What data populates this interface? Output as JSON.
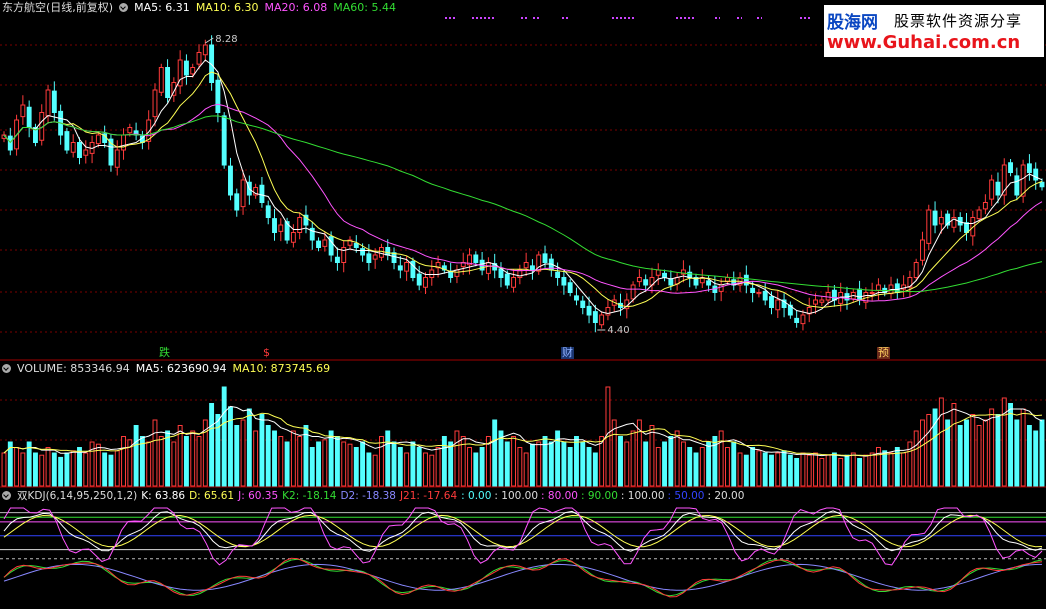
{
  "main_header": {
    "title": "东方航空(日线,前复权)",
    "ma5": "MA5: 6.31",
    "ma10": "MA10: 6.30",
    "ma20": "MA20: 6.08",
    "ma60": "MA60: 5.44"
  },
  "volume_header": {
    "title": "VOLUME: 853346.94",
    "ma5": "MA5: 623690.94",
    "ma10": "MA10: 873745.69"
  },
  "kdj_header": {
    "title": "双KDJ(6,14,95,250,1,2)",
    "k": "K: 63.86",
    "d": "D: 65.61",
    "j": "J: 60.35",
    "k2": "K2: -18.14",
    "d2": "D2: -18.38",
    "j21": "J21: -17.64",
    "v0": ": 0.00",
    "v100a": ": 100.00",
    "v80": ": 80.00",
    "v90": ": 90.00",
    "v100b": ": 100.00",
    "v50": ": 50.00",
    "v20": ": 20.00"
  },
  "logo": {
    "line1a": "股海网",
    "line1b": "股票软件资源分享",
    "line2": "www.Guhai.com.cn"
  },
  "annotations": {
    "high": "8.28",
    "low": "4.40",
    "marker_die": "跌",
    "marker_dollar": "$",
    "marker_cai": "财",
    "marker_yu": "预"
  },
  "colors": {
    "up": "#ff3b3b",
    "down": "#54ffff",
    "ma5": "#ffffff",
    "ma10": "#ffff55",
    "ma20": "#ff55ff",
    "ma60": "#33dd33",
    "grid": "#7a0000"
  },
  "chart_data": [
    {
      "type": "candlestick",
      "title": "东方航空(日线,前复权)",
      "x": "trading days (unlabeled)",
      "ylim": [
        4.2,
        8.6
      ],
      "annotations": [
        {
          "label": "8.28",
          "value": 8.28
        },
        {
          "label": "4.40",
          "value": 4.4
        }
      ],
      "close": [
        7.0,
        6.8,
        7.2,
        7.4,
        7.1,
        6.9,
        7.3,
        7.6,
        7.3,
        7.0,
        6.8,
        6.9,
        6.7,
        6.8,
        6.9,
        7.0,
        6.9,
        6.6,
        6.8,
        7.0,
        7.1,
        7.0,
        6.9,
        7.2,
        7.6,
        7.9,
        7.5,
        7.7,
        8.0,
        7.8,
        7.9,
        8.1,
        8.2,
        7.7,
        7.3,
        6.6,
        6.2,
        6.0,
        6.4,
        6.2,
        6.3,
        6.1,
        5.9,
        5.7,
        5.8,
        5.6,
        5.7,
        5.9,
        5.8,
        5.6,
        5.5,
        5.6,
        5.4,
        5.3,
        5.5,
        5.6,
        5.5,
        5.4,
        5.3,
        5.4,
        5.5,
        5.4,
        5.3,
        5.2,
        5.3,
        5.1,
        5.0,
        5.1,
        5.2,
        5.3,
        5.2,
        5.1,
        5.2,
        5.3,
        5.4,
        5.3,
        5.2,
        5.3,
        5.2,
        5.1,
        5.0,
        5.1,
        5.2,
        5.3,
        5.2,
        5.4,
        5.3,
        5.2,
        5.1,
        5.0,
        4.9,
        4.8,
        4.7,
        4.6,
        4.5,
        4.6,
        4.7,
        4.8,
        4.7,
        4.8,
        5.0,
        5.1,
        5.0,
        5.1,
        5.2,
        5.1,
        5.0,
        5.1,
        5.2,
        5.1,
        5.0,
        5.1,
        5.0,
        4.9,
        5.0,
        5.1,
        5.0,
        5.1,
        5.0,
        4.9,
        4.9,
        4.8,
        4.7,
        4.8,
        4.7,
        4.6,
        4.5,
        4.6,
        4.7,
        4.8,
        4.8,
        4.9,
        4.8,
        4.9,
        4.8,
        4.9,
        4.8,
        4.9,
        4.9,
        5.0,
        4.9,
        5.0,
        4.9,
        5.0,
        5.1,
        5.3,
        5.6,
        6.0,
        5.8,
        5.9,
        5.8,
        5.9,
        5.8,
        5.7,
        5.9,
        6.0,
        6.1,
        6.4,
        6.2,
        6.6,
        6.5,
        6.2,
        6.6,
        6.5,
        6.4,
        6.31
      ]
    },
    {
      "type": "bar",
      "title": "VOLUME: 853346.94",
      "series_names": [
        "MA5",
        "MA10"
      ],
      "values": [
        0.3,
        0.4,
        0.35,
        0.3,
        0.4,
        0.3,
        0.28,
        0.35,
        0.3,
        0.26,
        0.3,
        0.32,
        0.35,
        0.3,
        0.4,
        0.38,
        0.3,
        0.28,
        0.32,
        0.45,
        0.42,
        0.55,
        0.45,
        0.4,
        0.6,
        0.45,
        0.5,
        0.4,
        0.55,
        0.45,
        0.5,
        0.45,
        0.6,
        0.75,
        0.65,
        0.9,
        0.72,
        0.55,
        0.6,
        0.7,
        0.5,
        0.65,
        0.55,
        0.5,
        0.45,
        0.4,
        0.5,
        0.45,
        0.55,
        0.35,
        0.4,
        0.42,
        0.5,
        0.45,
        0.4,
        0.38,
        0.35,
        0.4,
        0.3,
        0.28,
        0.45,
        0.5,
        0.4,
        0.35,
        0.3,
        0.4,
        0.35,
        0.3,
        0.28,
        0.35,
        0.45,
        0.4,
        0.5,
        0.45,
        0.35,
        0.3,
        0.35,
        0.45,
        0.6,
        0.5,
        0.4,
        0.45,
        0.35,
        0.3,
        0.38,
        0.4,
        0.45,
        0.4,
        0.5,
        0.4,
        0.35,
        0.45,
        0.4,
        0.35,
        0.3,
        0.45,
        0.9,
        0.6,
        0.45,
        0.4,
        0.5,
        0.6,
        0.4,
        0.55,
        0.35,
        0.4,
        0.45,
        0.5,
        0.4,
        0.35,
        0.3,
        0.35,
        0.4,
        0.45,
        0.5,
        0.35,
        0.4,
        0.3,
        0.28,
        0.35,
        0.32,
        0.3,
        0.28,
        0.3,
        0.32,
        0.28,
        0.25,
        0.3,
        0.28,
        0.3,
        0.25,
        0.28,
        0.3,
        0.25,
        0.28,
        0.3,
        0.25,
        0.28,
        0.3,
        0.35,
        0.32,
        0.3,
        0.35,
        0.3,
        0.4,
        0.5,
        0.6,
        0.65,
        0.7,
        0.8,
        0.6,
        0.75,
        0.55,
        0.6,
        0.65,
        0.55,
        0.6,
        0.7,
        0.65,
        0.8,
        0.75,
        0.6,
        0.7,
        0.55,
        0.5,
        0.6
      ]
    },
    {
      "type": "line",
      "title": "双KDJ(6,14,95,250,1,2)",
      "series_names": [
        "K",
        "D",
        "J",
        "K2",
        "D2",
        "J21"
      ],
      "reference_levels": [
        0,
        20,
        50,
        80,
        90,
        100
      ]
    }
  ]
}
